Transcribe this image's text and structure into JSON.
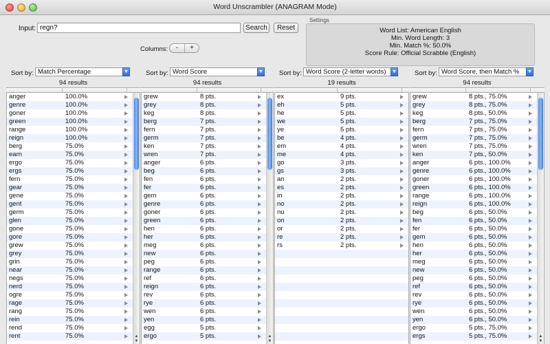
{
  "window": {
    "title": "Word Unscrambler (ANAGRAM Mode)"
  },
  "input": {
    "label": "Input:",
    "value": "regn?"
  },
  "buttons": {
    "search": "Search",
    "reset": "Reset"
  },
  "columns_control": {
    "label": "Columns:",
    "minus": "-",
    "plus": "+"
  },
  "settings": {
    "label": "Settings",
    "lines": [
      "Word List: American English",
      "Min. Word Length: 3",
      "Min. Match %: 50.0%",
      "Score Rule: Official Scrabble (English)"
    ]
  },
  "panels": [
    {
      "sort_label": "Sort by:",
      "sort_value": "Match Percentage",
      "results": "94 results",
      "rows": [
        [
          "anger",
          "100.0%"
        ],
        [
          "genre",
          "100.0%"
        ],
        [
          "goner",
          "100.0%"
        ],
        [
          "green",
          "100.0%"
        ],
        [
          "range",
          "100.0%"
        ],
        [
          "reign",
          "100.0%"
        ],
        [
          "berg",
          "75.0%"
        ],
        [
          "earn",
          "75.0%"
        ],
        [
          "ergo",
          "75.0%"
        ],
        [
          "ergs",
          "75.0%"
        ],
        [
          "fern",
          "75.0%"
        ],
        [
          "gear",
          "75.0%"
        ],
        [
          "gene",
          "75.0%"
        ],
        [
          "gent",
          "75.0%"
        ],
        [
          "germ",
          "75.0%"
        ],
        [
          "glen",
          "75.0%"
        ],
        [
          "gone",
          "75.0%"
        ],
        [
          "gore",
          "75.0%"
        ],
        [
          "grew",
          "75.0%"
        ],
        [
          "grey",
          "75.0%"
        ],
        [
          "grin",
          "75.0%"
        ],
        [
          "near",
          "75.0%"
        ],
        [
          "negs",
          "75.0%"
        ],
        [
          "nerd",
          "75.0%"
        ],
        [
          "ogre",
          "75.0%"
        ],
        [
          "rage",
          "75.0%"
        ],
        [
          "rang",
          "75.0%"
        ],
        [
          "rein",
          "75.0%"
        ],
        [
          "rend",
          "75.0%"
        ],
        [
          "rent",
          "75.0%"
        ]
      ],
      "scrollbar": {
        "thumb_start": 0.02,
        "thumb_size": 0.3
      }
    },
    {
      "sort_label": "Sort by:",
      "sort_value": "Word Score",
      "results": "94 results",
      "rows": [
        [
          "grew",
          "8 pts."
        ],
        [
          "grey",
          "8 pts."
        ],
        [
          "keg",
          "8 pts."
        ],
        [
          "berg",
          "7 pts."
        ],
        [
          "fern",
          "7 pts."
        ],
        [
          "germ",
          "7 pts."
        ],
        [
          "ken",
          "7 pts."
        ],
        [
          "wren",
          "7 pts."
        ],
        [
          "anger",
          "6 pts."
        ],
        [
          "beg",
          "6 pts."
        ],
        [
          "fen",
          "6 pts."
        ],
        [
          "fer",
          "6 pts."
        ],
        [
          "gem",
          "6 pts."
        ],
        [
          "genre",
          "6 pts."
        ],
        [
          "goner",
          "6 pts."
        ],
        [
          "green",
          "6 pts."
        ],
        [
          "hen",
          "6 pts."
        ],
        [
          "her",
          "6 pts."
        ],
        [
          "meg",
          "6 pts."
        ],
        [
          "new",
          "6 pts."
        ],
        [
          "peg",
          "6 pts."
        ],
        [
          "range",
          "6 pts."
        ],
        [
          "ref",
          "6 pts."
        ],
        [
          "reign",
          "6 pts."
        ],
        [
          "rev",
          "6 pts."
        ],
        [
          "rye",
          "6 pts."
        ],
        [
          "wen",
          "6 pts."
        ],
        [
          "yen",
          "6 pts."
        ],
        [
          "egg",
          "5 pts."
        ],
        [
          "ergo",
          "5 pts."
        ]
      ],
      "scrollbar": {
        "thumb_start": 0.02,
        "thumb_size": 0.3
      }
    },
    {
      "sort_label": "Sort by:",
      "sort_value": "Word Score (2-letter words)",
      "results": "19 results",
      "rows": [
        [
          "ex",
          "9 pts."
        ],
        [
          "eh",
          "5 pts."
        ],
        [
          "he",
          "5 pts."
        ],
        [
          "we",
          "5 pts."
        ],
        [
          "ye",
          "5 pts."
        ],
        [
          "be",
          "4 pts."
        ],
        [
          "em",
          "4 pts."
        ],
        [
          "me",
          "4 pts."
        ],
        [
          "go",
          "3 pts."
        ],
        [
          "gs",
          "3 pts."
        ],
        [
          "an",
          "2 pts."
        ],
        [
          "es",
          "2 pts."
        ],
        [
          "in",
          "2 pts."
        ],
        [
          "no",
          "2 pts."
        ],
        [
          "nu",
          "2 pts."
        ],
        [
          "on",
          "2 pts."
        ],
        [
          "or",
          "2 pts."
        ],
        [
          "re",
          "2 pts."
        ],
        [
          "rs",
          "2 pts."
        ]
      ],
      "scrollbar": null
    },
    {
      "sort_label": "Sort by:",
      "sort_value": "Word Score, then Match %",
      "results": "94 results",
      "rows": [
        [
          "grew",
          "8 pts., 75.0%"
        ],
        [
          "grey",
          "8 pts., 75.0%"
        ],
        [
          "keg",
          "8 pts., 50.0%"
        ],
        [
          "berg",
          "7 pts., 75.0%"
        ],
        [
          "fern",
          "7 pts., 75.0%"
        ],
        [
          "germ",
          "7 pts., 75.0%"
        ],
        [
          "wren",
          "7 pts., 75.0%"
        ],
        [
          "ken",
          "7 pts., 50.0%"
        ],
        [
          "anger",
          "6 pts., 100.0%"
        ],
        [
          "genre",
          "6 pts., 100.0%"
        ],
        [
          "goner",
          "6 pts., 100.0%"
        ],
        [
          "green",
          "6 pts., 100.0%"
        ],
        [
          "range",
          "6 pts., 100.0%"
        ],
        [
          "reign",
          "6 pts., 100.0%"
        ],
        [
          "beg",
          "6 pts., 50.0%"
        ],
        [
          "fen",
          "6 pts., 50.0%"
        ],
        [
          "fer",
          "6 pts., 50.0%"
        ],
        [
          "gem",
          "6 pts., 50.0%"
        ],
        [
          "hen",
          "6 pts., 50.0%"
        ],
        [
          "her",
          "6 pts., 50.0%"
        ],
        [
          "meg",
          "6 pts., 50.0%"
        ],
        [
          "new",
          "6 pts., 50.0%"
        ],
        [
          "peg",
          "6 pts., 50.0%"
        ],
        [
          "ref",
          "6 pts., 50.0%"
        ],
        [
          "rev",
          "6 pts., 50.0%"
        ],
        [
          "rye",
          "6 pts., 50.0%"
        ],
        [
          "wen",
          "6 pts., 50.0%"
        ],
        [
          "yen",
          "6 pts., 50.0%"
        ],
        [
          "ergo",
          "5 pts., 75.0%"
        ],
        [
          "ergs",
          "5 pts., 75.0%"
        ]
      ],
      "scrollbar": {
        "thumb_start": 0.02,
        "thumb_size": 0.3
      }
    }
  ]
}
